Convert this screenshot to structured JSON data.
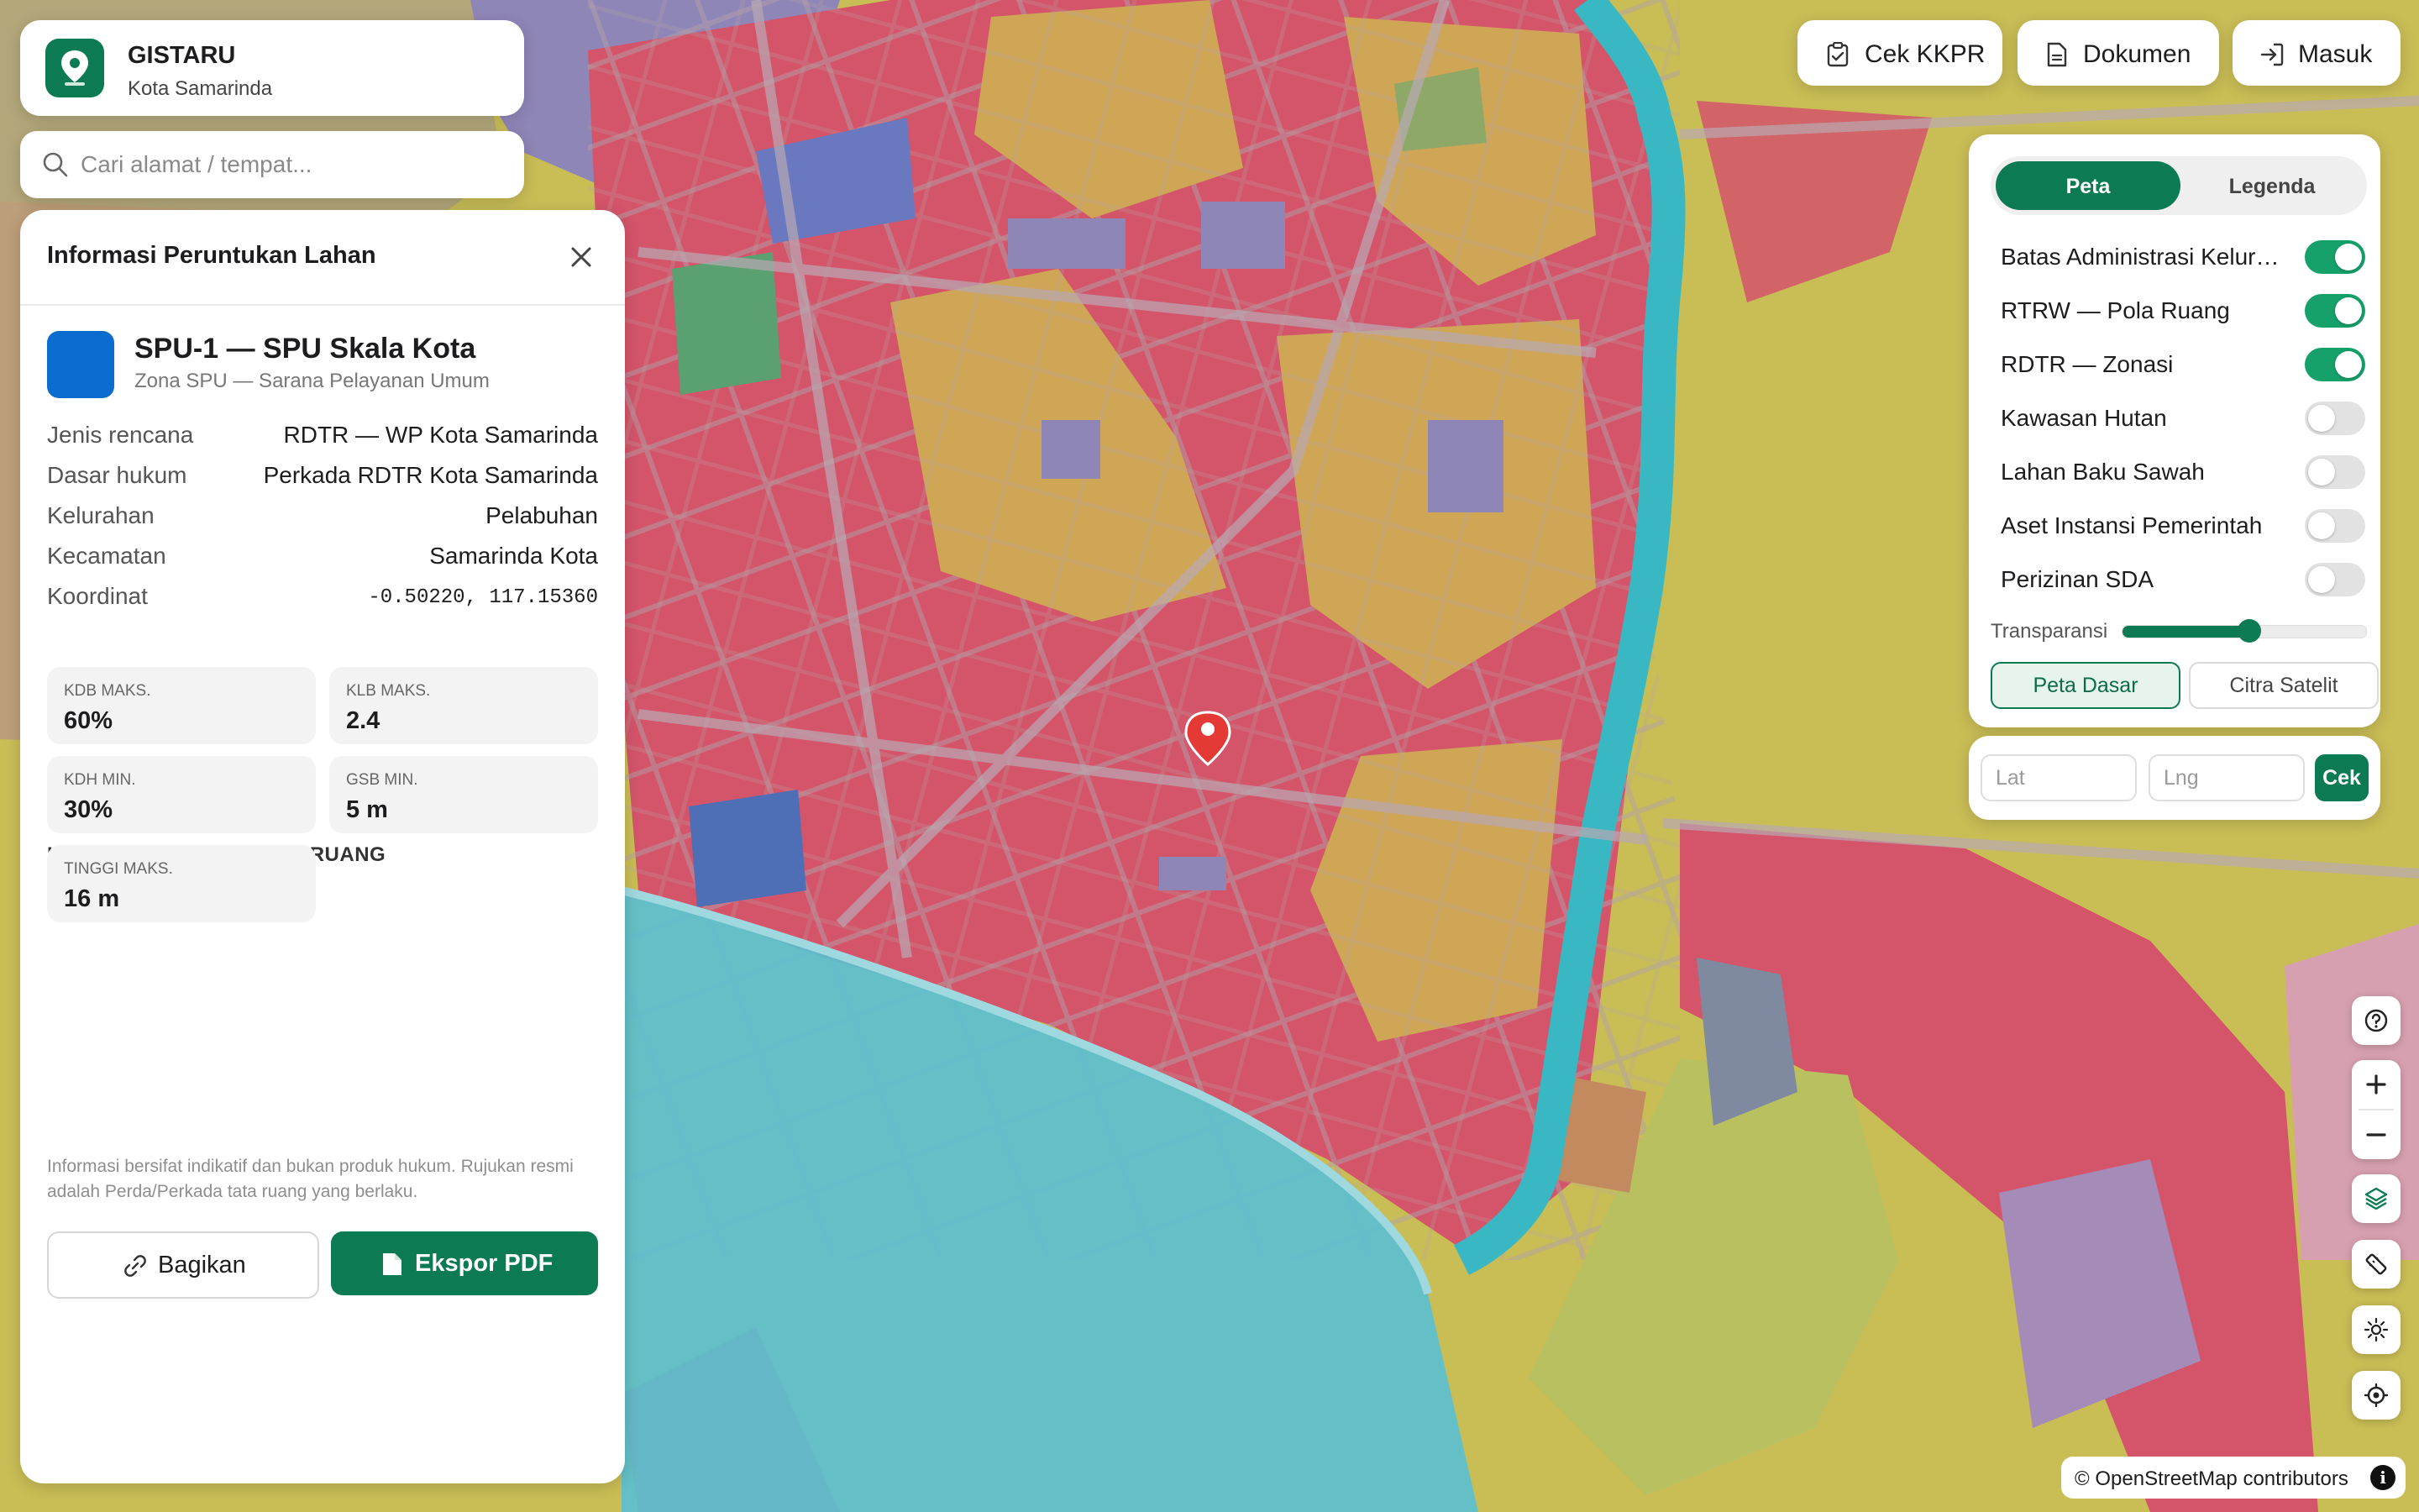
{
  "app": {
    "name": "GISTARU",
    "subtitle": "Kota Samarinda"
  },
  "search": {
    "placeholder": "Cari alamat / tempat..."
  },
  "top_nav": {
    "kkpr_label": "Cek KKPR",
    "dokumen_label": "Dokumen",
    "masuk_label": "Masuk"
  },
  "info_panel": {
    "title": "Informasi Peruntukan Lahan",
    "zone_title": "SPU-1 — SPU Skala Kota",
    "zone_subtitle": "Zona SPU — Sarana Pelayanan Umum",
    "zone_color": "#0a6ccf",
    "details": [
      {
        "key": "Jenis rencana",
        "value": "RDTR — WP Kota Samarinda"
      },
      {
        "key": "Dasar hukum",
        "value": "Perkada RDTR Kota Samarinda"
      },
      {
        "key": "Kelurahan",
        "value": "Pelabuhan"
      },
      {
        "key": "Kecamatan",
        "value": "Samarinda Kota"
      },
      {
        "key": "Koordinat",
        "value": "-0.50220, 117.15360"
      }
    ],
    "section_title": "KETENTUAN INTENSITAS RUANG",
    "stats": [
      {
        "label": "KDB MAKS.",
        "value": "60%"
      },
      {
        "label": "KLB MAKS.",
        "value": "2.4"
      },
      {
        "label": "KDH MIN.",
        "value": "30%"
      },
      {
        "label": "GSB MIN.",
        "value": "5 m"
      },
      {
        "label": "TINGGI MAKS.",
        "value": "16 m"
      }
    ],
    "note": "Informasi bersifat indikatif dan bukan produk hukum. Rujukan resmi adalah Perda/Perkada tata ruang yang berlaku.",
    "share_label": "Bagikan",
    "pdf_label": "Ekspor PDF"
  },
  "layer_panel": {
    "tab_active": "Peta",
    "tab_inactive": "Legenda",
    "layers": [
      {
        "label": "Batas Administrasi Kelurahan",
        "on": true
      },
      {
        "label": "RTRW — Pola Ruang",
        "on": true
      },
      {
        "label": "RDTR — Zonasi",
        "on": true
      },
      {
        "label": "Kawasan Hutan",
        "on": false
      },
      {
        "label": "Lahan Baku Sawah",
        "on": false
      },
      {
        "label": "Aset Instansi Pemerintah",
        "on": false
      },
      {
        "label": "Perizinan SDA",
        "on": false
      }
    ],
    "transparency_label": "Transparansi",
    "transparency_value": 0.52,
    "basemap_active": "Peta Dasar",
    "basemap_other": "Citra Satelit"
  },
  "coordinate_search": {
    "lat_placeholder": "Lat",
    "lng_placeholder": "Lng",
    "button_label": "Cek"
  },
  "map": {
    "attribution": "© OpenStreetMap contributors",
    "marker_color": "#e53935",
    "zone_colors": {
      "perdagangan": "#d4546a",
      "perumahan": "#cfa556",
      "perkantoran": "#8f86b8",
      "ruang_terbuka": "#5aa070",
      "perairan": "#5bbfcf",
      "sungai": "#39b8c4",
      "campuran": "#c9bd56"
    },
    "controls": [
      "help-icon",
      "zoom-in-icon",
      "zoom-out-icon",
      "layers-icon",
      "ruler-icon",
      "brightness-icon",
      "locate-icon"
    ]
  }
}
